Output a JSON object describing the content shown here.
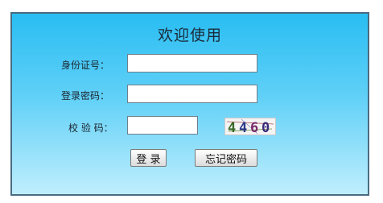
{
  "login": {
    "title": "欢迎使用",
    "id_label": "身份证号：",
    "id_value": "",
    "password_label": "登录密码：",
    "password_value": "",
    "code_label": "校 验 码：",
    "code_value": "",
    "captcha_text": "4460",
    "login_button": "登 录",
    "forgot_button": "忘记密码"
  }
}
